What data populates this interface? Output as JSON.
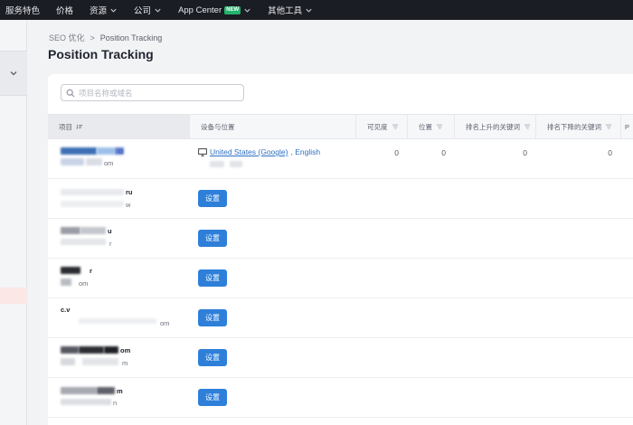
{
  "topnav": {
    "items": [
      {
        "label": "服务特色",
        "chevron": false
      },
      {
        "label": "价格",
        "chevron": false
      },
      {
        "label": "资源",
        "chevron": true
      },
      {
        "label": "公司",
        "chevron": true
      },
      {
        "label": "App Center",
        "chevron": true,
        "badge": "NEW"
      },
      {
        "label": "其他工具",
        "chevron": true
      }
    ]
  },
  "breadcrumb": {
    "parent": "SEO 优化",
    "separator": ">",
    "current": "Position Tracking"
  },
  "page": {
    "title": "Position Tracking"
  },
  "search": {
    "placeholder": "项目名称或域名",
    "value": ""
  },
  "table": {
    "columns": [
      "项目",
      "设备与位置",
      "可见度",
      "位置",
      "排名上升的关键词",
      "排名下降的关键词",
      "P"
    ],
    "rows": [
      {
        "fragments": [
          "D",
          "om"
        ],
        "location_link": "United States (Google)",
        "location_lang": ", English",
        "visibility": "0",
        "position": "0",
        "keywords_up": "0",
        "keywords_down": "0"
      },
      {
        "fragments": [
          "ru",
          "w"
        ],
        "button": "设置"
      },
      {
        "fragments": [
          "u",
          "r"
        ],
        "button": "设置"
      },
      {
        "fragments": [
          "r",
          "om"
        ],
        "button": "设置"
      },
      {
        "fragments": [
          "c.v",
          "om"
        ],
        "button": "设置"
      },
      {
        "fragments": [
          "om",
          "m"
        ],
        "button": "设置"
      },
      {
        "fragments": [
          "m",
          "n"
        ],
        "button": "设置"
      }
    ]
  },
  "colors": {
    "nav_bg": "#1b1d24",
    "accent_button": "#2e7fd9",
    "link": "#2e6fc4",
    "badge": "#23b26d"
  }
}
